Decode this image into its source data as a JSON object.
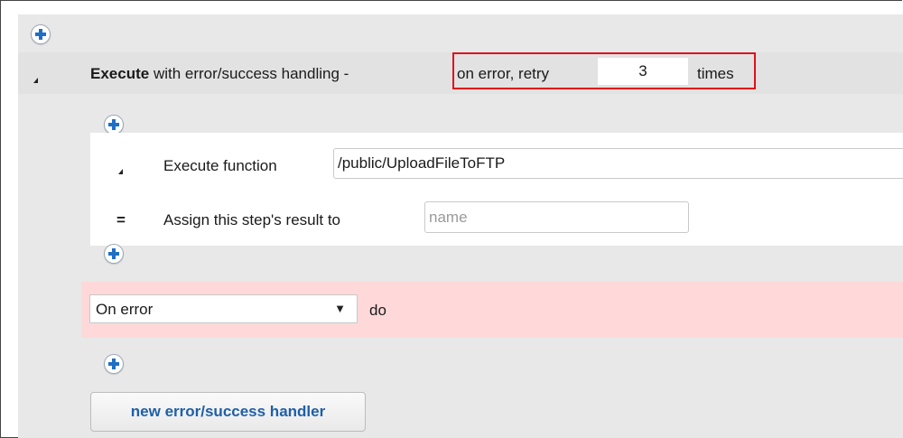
{
  "step": {
    "keyword": "Execute",
    "description": "with error/success handling -",
    "retry_prefix": "on error, retry",
    "retry_count": "3",
    "retry_suffix": "times"
  },
  "execute_function": {
    "label": "Execute function",
    "value": "/public/UploadFileToFTP",
    "expand_icon": "triangle-expanded-icon"
  },
  "assign": {
    "operator": "=",
    "label": "Assign this step's result to",
    "placeholder": "name"
  },
  "handler": {
    "condition_selected": "On error",
    "do_label": "do",
    "dropdown_icon": "caret-down-icon"
  },
  "new_handler_button": "new error/success handler",
  "icons": {
    "add": "plus-circle-icon"
  },
  "colors": {
    "accent_blue": "#1f6fc5",
    "highlight_red": "#e0101b",
    "error_band": "#ffd9d9"
  }
}
